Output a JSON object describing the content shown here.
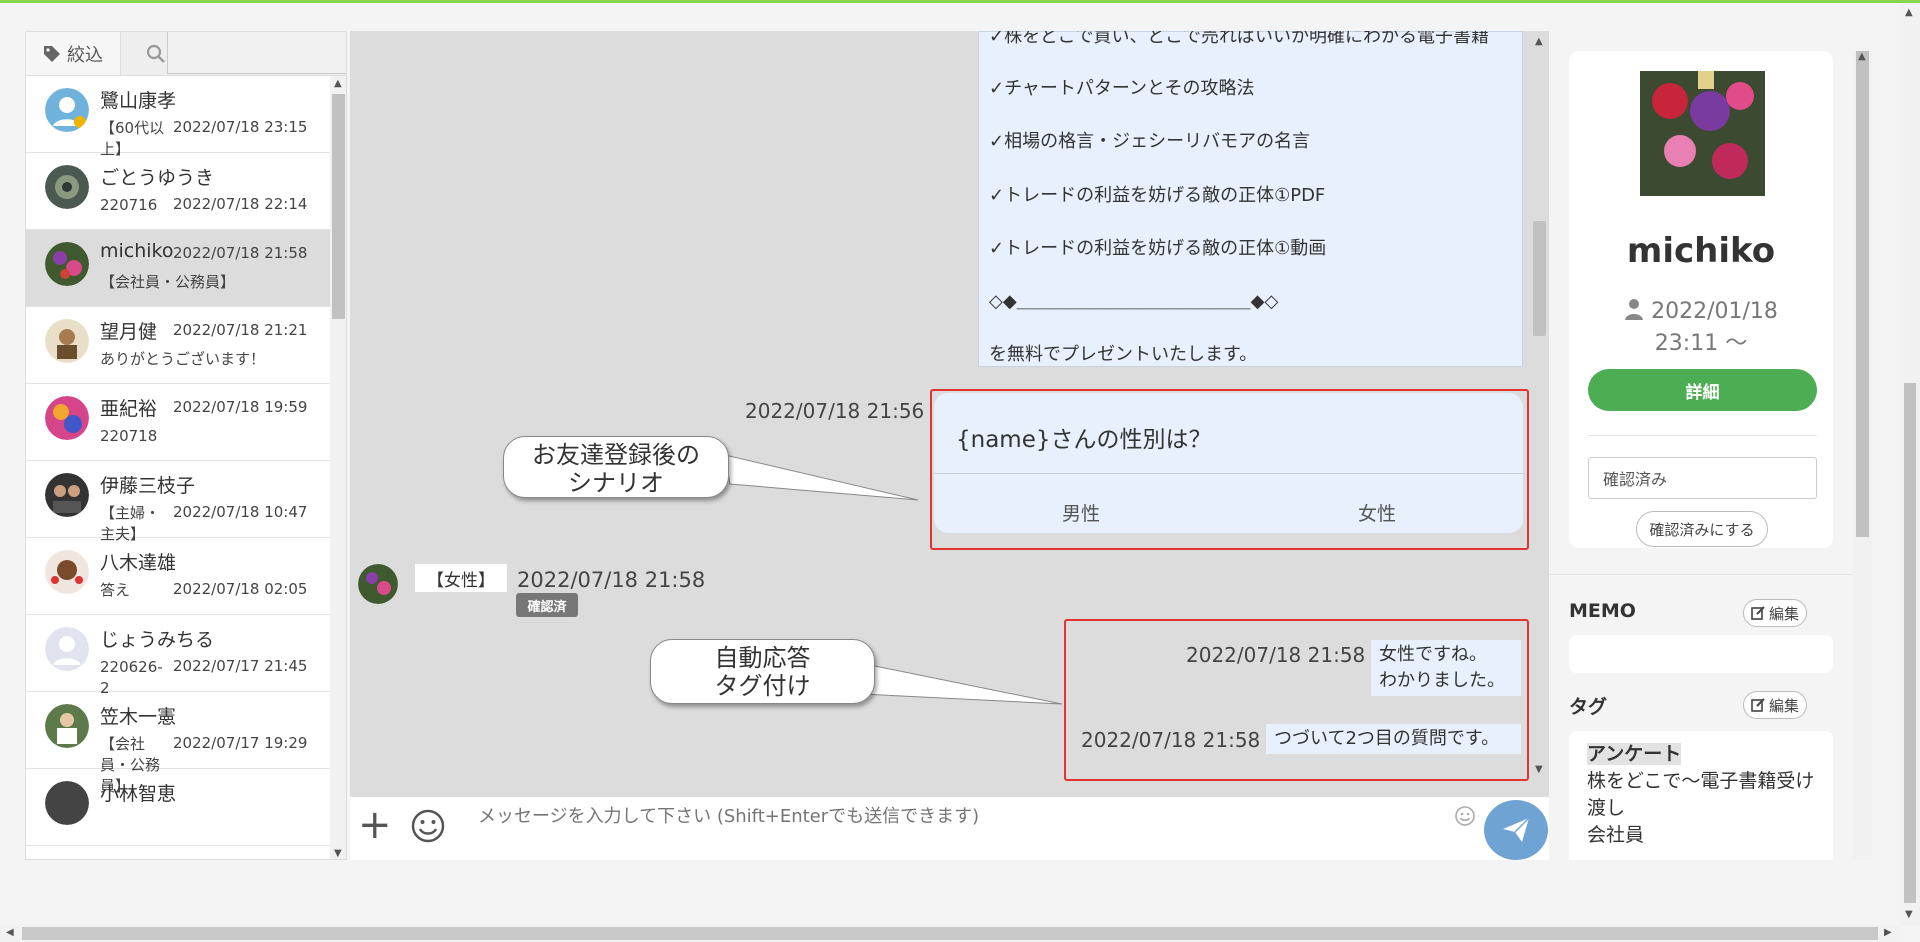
{
  "filter": {
    "tab_label": "絞込",
    "search_placeholder": ""
  },
  "contacts": [
    {
      "name": "鷺山康孝",
      "meta": "【60代以上】",
      "time": "2022/07/18 23:15"
    },
    {
      "name": "ごとうゆうき",
      "meta": "220716",
      "time": "2022/07/18 22:14"
    },
    {
      "name": "michiko",
      "meta": "【会社員・公務員】",
      "time": "2022/07/18 21:58"
    },
    {
      "name": "望月健",
      "meta": "ありがとうございます！",
      "time": "2022/07/18 21:21"
    },
    {
      "name": "亜紀裕",
      "meta": "220718",
      "time": "2022/07/18 19:59"
    },
    {
      "name": "伊藤三枝子",
      "meta": "【主婦・主夫】",
      "time": "2022/07/18 10:47"
    },
    {
      "name": "八木達雄",
      "meta": "答え",
      "time": "2022/07/18 02:05"
    },
    {
      "name": "じょうみちる",
      "meta": "220626-2",
      "time": "2022/07/17 21:45"
    },
    {
      "name": "笠木一憲",
      "meta": "【会社員・公務員】",
      "time": "2022/07/17 19:29"
    },
    {
      "name": "小林智恵",
      "meta": "",
      "time": ""
    }
  ],
  "chat": {
    "message_lines": [
      "✓株をどこで買い、どこで売ればいいか明確にわかる電子書籍",
      "✓チャートパターンとその攻略法",
      "✓相場の格言・ジェシーリバモアの名言",
      "✓トレードの利益を妨げる敵の正体①PDF",
      "✓トレードの利益を妨げる敵の正体①動画",
      "◇◆＿＿＿＿＿＿＿＿＿＿＿＿＿◆◇",
      "を無料でプレゼントいたします。"
    ],
    "question_time": "2022/07/18 21:56",
    "question_text": "{name}さんの性別は？",
    "option_male": "男性",
    "option_female": "女性",
    "callout_scenario": [
      "お友達登録後の",
      "シナリオ"
    ],
    "user_answer": "【女性】",
    "user_time": "2022/07/18 21:58",
    "confirmed_badge": "確認済",
    "callout_auto": [
      "自動応答",
      "タグ付け"
    ],
    "reply1_time": "2022/07/18 21:58",
    "reply1_lines": [
      "女性ですね。",
      "わかりました。"
    ],
    "reply2_time": "2022/07/18 21:58",
    "reply2_text": "つづいて2つ目の質問です。",
    "input_placeholder": "メッセージを入力して下さい (Shift+Enterでも送信できます)"
  },
  "profile": {
    "name": "michiko",
    "date_line1": "2022/01/18",
    "date_line2": "23:11 〜",
    "detail_button": "詳細",
    "status_value": "確認済み",
    "confirm_button": "確認済みにする",
    "memo_title": "MEMO",
    "edit_label": "編集",
    "tag_title": "タグ",
    "tags_head": "アンケート",
    "tags": [
      "株をどこで〜電子書籍受け渡し",
      "会社員"
    ]
  },
  "colors": {
    "accent_green": "#4cad53",
    "highlight_red": "#e23333",
    "bubble_blue": "#e8f0fd",
    "send_blue": "#6fa3d4"
  }
}
